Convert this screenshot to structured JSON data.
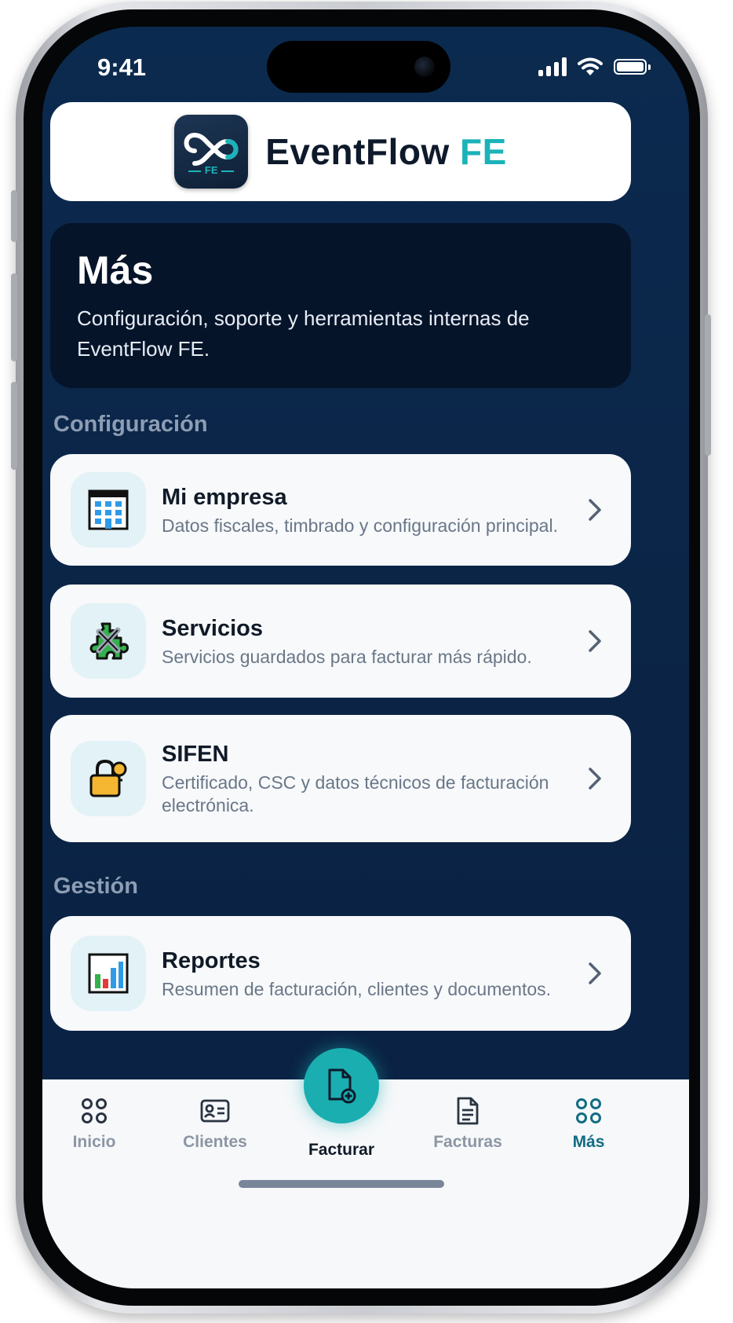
{
  "status_bar": {
    "time": "9:41"
  },
  "header": {
    "logo_text": "FE",
    "app_name_main": "EventFlow",
    "app_name_accent": "FE"
  },
  "intro": {
    "title": "Más",
    "subtitle": "Configuración, soporte y herramientas internas de EventFlow FE."
  },
  "sections": [
    {
      "title": "Configuración",
      "items": [
        {
          "title": "Mi empresa",
          "description": "Datos fiscales, timbrado y configuración principal.",
          "icon": "building-icon"
        },
        {
          "title": "Servicios",
          "description": "Servicios guardados para facturar más rápido.",
          "icon": "puzzle-tools-icon"
        },
        {
          "title": "SIFEN",
          "description": "Certificado, CSC y datos técnicos de facturación electrónica.",
          "icon": "lock-key-icon"
        }
      ]
    },
    {
      "title": "Gestión",
      "items": [
        {
          "title": "Reportes",
          "description": "Resumen de facturación, clientes y documentos.",
          "icon": "bar-chart-icon"
        }
      ]
    }
  ],
  "tab_bar": {
    "tabs": [
      {
        "label": "Inicio",
        "icon": "grid-icon"
      },
      {
        "label": "Clientes",
        "icon": "id-card-icon"
      },
      {
        "label": "Facturar",
        "icon": "new-document-icon"
      },
      {
        "label": "Facturas",
        "icon": "document-icon"
      },
      {
        "label": "Más",
        "icon": "grid-icon"
      }
    ],
    "active_tab": "Más"
  },
  "colors": {
    "background": "#0b2a4f",
    "accent": "#1ab3b8",
    "active_tab": "#126c83",
    "card": "#f7f9fb"
  }
}
